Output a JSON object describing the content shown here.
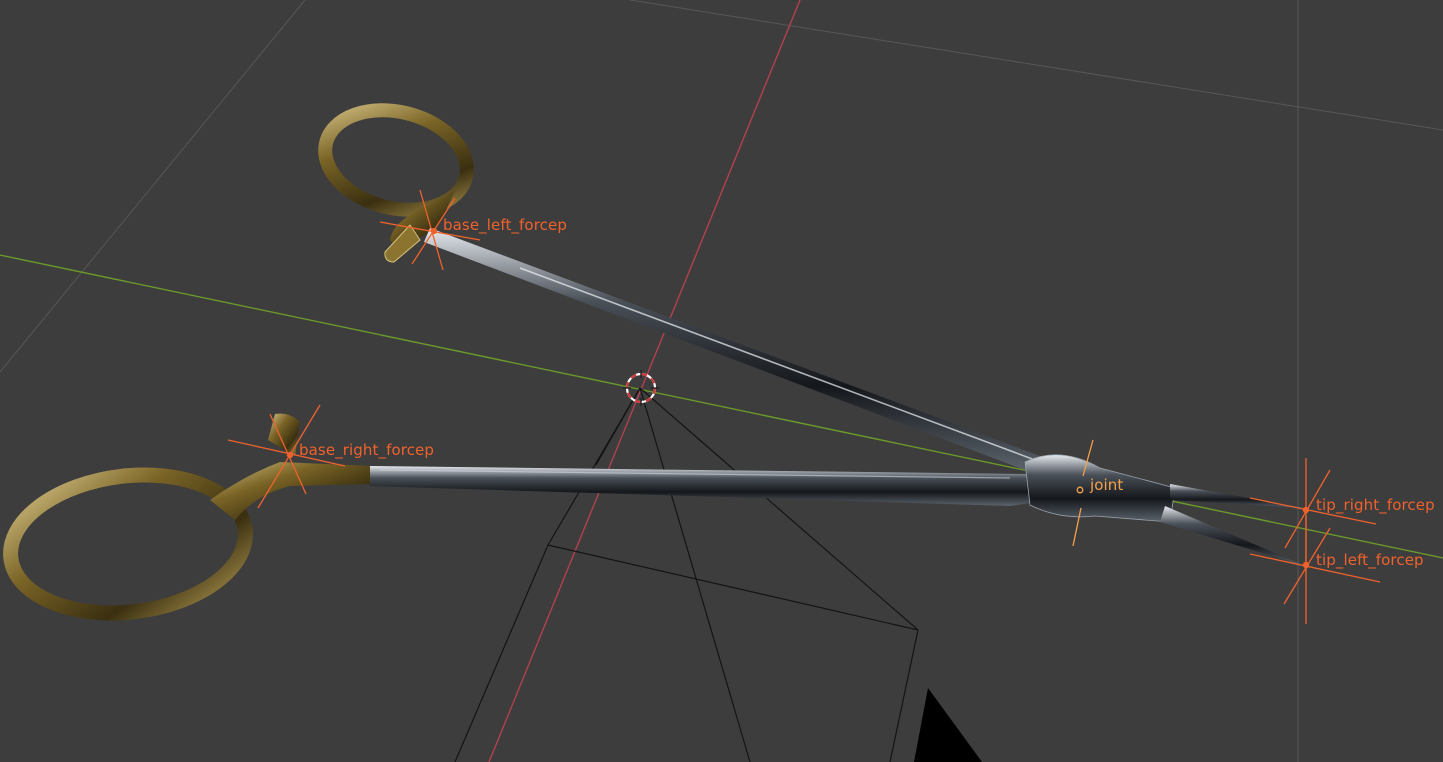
{
  "viewport": {
    "background": "#3d3d3d",
    "grid_color": "#555555",
    "x_axis_color": "#b2404f",
    "y_axis_color": "#6b9a2a",
    "camera_wire_color": "#111111"
  },
  "empties": {
    "base_left": {
      "label": "base_left_forcep"
    },
    "base_right": {
      "label": "base_right_forcep"
    },
    "joint": {
      "label": "joint"
    },
    "tip_right": {
      "label": "tip_right_forcep"
    },
    "tip_left": {
      "label": "tip_left_forcep"
    }
  },
  "colors": {
    "label_selected": "#f0622c",
    "label_active": "#f5a04a",
    "empty_selected": "#f0622c",
    "empty_active": "#f5a04a",
    "handle_gold": "#8a7430",
    "steel_dark": "#1c1f24",
    "steel_light": "#d9dde3"
  },
  "icons": {
    "cursor": "3d-cursor-icon"
  }
}
